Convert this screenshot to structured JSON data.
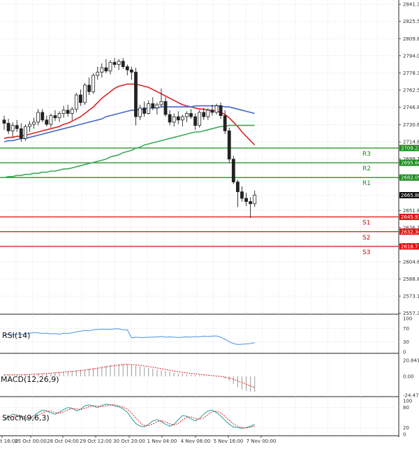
{
  "chart_data": {
    "type": "candlestick",
    "symbol": "",
    "price_axis": {
      "ticks": [
        "2841.30",
        "2825.55",
        "2809.80",
        "2794.05",
        "2778.30",
        "2762.55",
        "2746.80",
        "2730.60",
        "2714.85",
        "2699.10",
        "2682.09",
        "2665.60",
        "2651.85",
        "2636.10",
        "2620.35",
        "2604.60",
        "2588.85",
        "2573.10",
        "2557.35"
      ],
      "min": 2557.35,
      "max": 2841.3,
      "last_price": "2665.88"
    },
    "time_axis": {
      "labels": [
        "24 Oct 16:00",
        "25 Oct 00:00",
        "28 Oct 04:00",
        "29 Oct 12:00",
        "30 Oct 20:00",
        "1 Nov 04:00",
        "4 Nov 08:00",
        "5 Nov 16:00",
        "7 Nov 00:00"
      ]
    },
    "levels": [
      {
        "name": "R3",
        "price": 2709.23,
        "price_label": "2709.23",
        "color": "#1a8a1a"
      },
      {
        "name": "R2",
        "price": 2695.66,
        "price_label": "2695.66",
        "color": "#1a8a1a"
      },
      {
        "name": "R1",
        "price": 2682.09,
        "price_label": "2682.09",
        "color": "#1a8a1a"
      },
      {
        "name": "S1",
        "price": 2645.91,
        "price_label": "2645.91",
        "color": "#e01010"
      },
      {
        "name": "S2",
        "price": 2632.34,
        "price_label": "2632.34",
        "color": "#e01010"
      },
      {
        "name": "S3",
        "price": 2618.77,
        "price_label": "2618.77",
        "color": "#e01010"
      }
    ],
    "candles": [
      [
        2735,
        2739,
        2726,
        2732
      ],
      [
        2732,
        2736,
        2722,
        2725
      ],
      [
        2725,
        2733,
        2719,
        2730
      ],
      [
        2730,
        2735,
        2724,
        2727
      ],
      [
        2727,
        2732,
        2715,
        2718
      ],
      [
        2718,
        2731,
        2716,
        2729
      ],
      [
        2729,
        2734,
        2724,
        2731
      ],
      [
        2731,
        2737,
        2727,
        2733
      ],
      [
        2733,
        2745,
        2730,
        2742
      ],
      [
        2742,
        2745,
        2733,
        2735
      ],
      [
        2735,
        2739,
        2729,
        2731
      ],
      [
        2731,
        2741,
        2728,
        2739
      ],
      [
        2739,
        2744,
        2734,
        2737
      ],
      [
        2737,
        2743,
        2733,
        2741
      ],
      [
        2741,
        2748,
        2737,
        2744
      ],
      [
        2744,
        2749,
        2738,
        2741
      ],
      [
        2741,
        2747,
        2735,
        2745
      ],
      [
        2745,
        2760,
        2742,
        2758
      ],
      [
        2758,
        2763,
        2748,
        2751
      ],
      [
        2751,
        2769,
        2749,
        2767
      ],
      [
        2767,
        2774,
        2758,
        2761
      ],
      [
        2761,
        2778,
        2759,
        2776
      ],
      [
        2776,
        2784,
        2772,
        2779
      ],
      [
        2779,
        2787,
        2774,
        2783
      ],
      [
        2783,
        2791,
        2778,
        2780
      ],
      [
        2780,
        2790,
        2777,
        2788
      ],
      [
        2788,
        2792,
        2783,
        2786
      ],
      [
        2786,
        2791,
        2781,
        2789
      ],
      [
        2789,
        2792,
        2782,
        2784
      ],
      [
        2784,
        2786,
        2776,
        2781
      ],
      [
        2781,
        2784,
        2772,
        2779
      ],
      [
        2779,
        2783,
        2730,
        2738
      ],
      [
        2738,
        2749,
        2735,
        2746
      ],
      [
        2746,
        2752,
        2738,
        2741
      ],
      [
        2741,
        2753,
        2740,
        2750
      ],
      [
        2750,
        2756,
        2744,
        2746
      ],
      [
        2746,
        2751,
        2740,
        2749
      ],
      [
        2749,
        2764,
        2747,
        2752
      ],
      [
        2752,
        2756,
        2738,
        2740
      ],
      [
        2740,
        2744,
        2730,
        2733
      ],
      [
        2733,
        2741,
        2729,
        2738
      ],
      [
        2738,
        2743,
        2731,
        2735
      ],
      [
        2735,
        2740,
        2729,
        2738
      ],
      [
        2738,
        2743,
        2733,
        2741
      ],
      [
        2741,
        2745,
        2736,
        2738
      ],
      [
        2738,
        2741,
        2726,
        2730
      ],
      [
        2730,
        2744,
        2728,
        2742
      ],
      [
        2742,
        2746,
        2735,
        2738
      ],
      [
        2738,
        2746,
        2735,
        2744
      ],
      [
        2744,
        2749,
        2739,
        2742
      ],
      [
        2742,
        2750,
        2740,
        2748
      ],
      [
        2748,
        2751,
        2736,
        2739
      ],
      [
        2739,
        2744,
        2722,
        2725
      ],
      [
        2725,
        2728,
        2696,
        2699
      ],
      [
        2699,
        2702,
        2676,
        2678
      ],
      [
        2678,
        2680,
        2655,
        2669
      ],
      [
        2669,
        2674,
        2660,
        2663
      ],
      [
        2663,
        2668,
        2656,
        2660
      ],
      [
        2660,
        2664,
        2645,
        2658
      ],
      [
        2658,
        2670,
        2655,
        2666
      ]
    ],
    "moving_averages": [
      {
        "color": "#e02020",
        "values": [
          2718,
          2719,
          2719,
          2720,
          2720,
          2721,
          2722,
          2723,
          2724,
          2725,
          2726,
          2727,
          2728,
          2729,
          2731,
          2732,
          2734,
          2736,
          2738,
          2741,
          2744,
          2747,
          2751,
          2755,
          2758,
          2761,
          2764,
          2766,
          2767,
          2768,
          2768,
          2768,
          2767,
          2766,
          2765,
          2763,
          2761,
          2759,
          2757,
          2755,
          2753,
          2751,
          2749,
          2748,
          2747,
          2746,
          2745,
          2745,
          2744,
          2744,
          2743,
          2742,
          2740,
          2737,
          2733,
          2729,
          2724,
          2720,
          2716,
          2712
        ]
      },
      {
        "color": "#4466cc",
        "values": [
          2715,
          2716,
          2716,
          2717,
          2718,
          2718,
          2719,
          2720,
          2721,
          2722,
          2723,
          2724,
          2725,
          2726,
          2727,
          2728,
          2729,
          2730,
          2731,
          2732,
          2733,
          2734,
          2735,
          2736,
          2738,
          2739,
          2740,
          2741,
          2742,
          2743,
          2744,
          2744,
          2745,
          2745,
          2746,
          2746,
          2746,
          2747,
          2747,
          2747,
          2747,
          2747,
          2747,
          2747,
          2747,
          2748,
          2748,
          2748,
          2748,
          2748,
          2748,
          2748,
          2747,
          2747,
          2746,
          2745,
          2744,
          2743,
          2742,
          2741
        ]
      },
      {
        "color": "#3aaa5a",
        "values": [
          2682,
          2683,
          2683,
          2684,
          2684,
          2685,
          2685,
          2686,
          2686,
          2687,
          2687,
          2688,
          2688,
          2689,
          2690,
          2690,
          2691,
          2692,
          2693,
          2694,
          2695,
          2696,
          2697,
          2698,
          2699,
          2701,
          2702,
          2703,
          2705,
          2706,
          2707,
          2709,
          2710,
          2712,
          2713,
          2714,
          2715,
          2716,
          2717,
          2718,
          2719,
          2720,
          2721,
          2722,
          2723,
          2724,
          2724,
          2725,
          2726,
          2727,
          2728,
          2729,
          2729,
          2730,
          2730,
          2730,
          2730,
          2730,
          2730,
          2730
        ]
      }
    ],
    "rsi": {
      "label": "RSI(14)",
      "ticks": [
        "100",
        "70",
        "30",
        "0"
      ],
      "values": [
        52,
        52,
        51,
        53,
        52,
        54,
        56,
        58,
        57,
        55,
        56,
        54,
        55,
        53,
        56,
        55,
        57,
        60,
        62,
        64,
        63,
        66,
        67,
        68,
        68,
        67,
        69,
        69,
        66,
        66,
        42,
        44,
        43,
        43,
        44,
        44,
        45,
        46,
        44,
        45,
        44,
        43,
        44,
        45,
        44,
        46,
        45,
        47,
        46,
        47,
        48,
        44,
        38,
        30,
        25,
        22,
        23,
        24,
        25,
        28
      ]
    },
    "macd": {
      "label": "MACD(12,26,9)",
      "ticks": [
        "20.841",
        "0.00",
        "-24.476"
      ],
      "histogram": [
        2,
        2,
        1.5,
        2,
        2,
        2.5,
        3,
        3,
        3.5,
        4,
        4,
        4.5,
        5,
        5.5,
        6,
        6.5,
        7,
        8,
        8.5,
        9,
        10,
        11,
        12,
        13,
        14,
        15,
        15.5,
        16,
        16,
        16,
        15,
        14,
        13,
        12,
        11,
        10,
        9,
        8,
        7,
        6,
        5,
        4,
        3.5,
        3,
        2.5,
        2,
        1.5,
        1,
        0.5,
        0,
        -0.5,
        -1,
        -3,
        -6,
        -10,
        -14,
        -17,
        -19,
        -20,
        -20
      ],
      "signal": [
        2,
        2,
        2,
        2,
        2,
        2.2,
        2.5,
        2.8,
        3,
        3.4,
        3.8,
        4.2,
        4.6,
        5,
        5.5,
        6,
        6.5,
        7,
        7.6,
        8.2,
        8.9,
        9.7,
        10.5,
        11.4,
        12.3,
        13.2,
        14,
        14.6,
        15.1,
        15.4,
        15.3,
        14.9,
        14.3,
        13.6,
        12.8,
        11.9,
        11,
        10,
        9,
        8,
        7,
        6.1,
        5.3,
        4.6,
        3.9,
        3.3,
        2.7,
        2.1,
        1.5,
        1,
        0.5,
        0,
        -1,
        -2.2,
        -3.8,
        -5.8,
        -8,
        -10.2,
        -12.4,
        -14.4
      ]
    },
    "stoch": {
      "label": "Stoch(9,6,3)",
      "ticks": [
        "100",
        "80",
        "20",
        "0"
      ],
      "k": [
        45,
        52,
        60,
        58,
        50,
        44,
        48,
        56,
        65,
        72,
        70,
        64,
        60,
        66,
        74,
        80,
        78,
        70,
        75,
        85,
        88,
        84,
        80,
        86,
        90,
        88,
        85,
        82,
        76,
        66,
        48,
        32,
        25,
        22,
        30,
        40,
        44,
        38,
        30,
        24,
        30,
        44,
        56,
        54,
        46,
        40,
        48,
        60,
        70,
        72,
        65,
        55,
        42,
        30,
        22,
        20,
        18,
        20,
        24,
        30
      ],
      "d": [
        50,
        50,
        53,
        56,
        56,
        51,
        47,
        49,
        56,
        64,
        69,
        69,
        65,
        63,
        67,
        73,
        77,
        76,
        74,
        77,
        83,
        86,
        84,
        83,
        85,
        88,
        88,
        85,
        81,
        75,
        63,
        49,
        35,
        26,
        26,
        31,
        38,
        41,
        37,
        31,
        28,
        33,
        43,
        51,
        52,
        47,
        45,
        49,
        59,
        67,
        69,
        64,
        54,
        42,
        31,
        24,
        20,
        19,
        21,
        25
      ]
    }
  }
}
